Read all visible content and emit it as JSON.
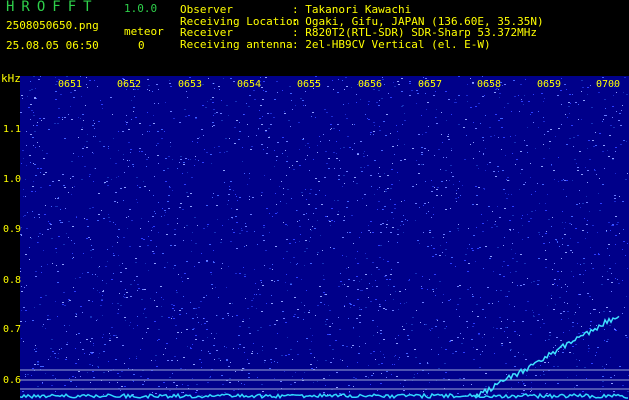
{
  "header": {
    "app_title": "HROFFT",
    "app_version": "1.0.0",
    "filename": "2508050650.png",
    "meteor_label": "meteor",
    "datetime": "25.08.05 06:50",
    "meteor_count": "0"
  },
  "info": {
    "observer_label": "Observer",
    "observer_value": ": Takanori Kawachi",
    "location_label": "Receiving Location",
    "location_value": ": Ogaki, Gifu, JAPAN (136.60E, 35.35N)",
    "receiver_label": "Receiver",
    "receiver_value": ": R820T2(RTL-SDR) SDR-Sharp 53.372MHz",
    "antenna_label": "Receiving antenna",
    "antenna_value": ": 2el-HB9CV Vertical (el. E-W)"
  },
  "axis": {
    "y_unit": "kHz",
    "y_ticks": [
      "1.1",
      "1.0",
      "0.9",
      "0.8",
      "0.7",
      "0.6"
    ],
    "x_ticks": [
      "0651",
      "0652",
      "0653",
      "0654",
      "0655",
      "0656",
      "0657",
      "0658",
      "0659",
      "0700"
    ]
  },
  "colors": {
    "background": "#000000",
    "plot_background": "#00008a",
    "title_color": "#2ecf4a",
    "text_color": "#ffff00",
    "trace_color": "#40e0ff"
  }
}
